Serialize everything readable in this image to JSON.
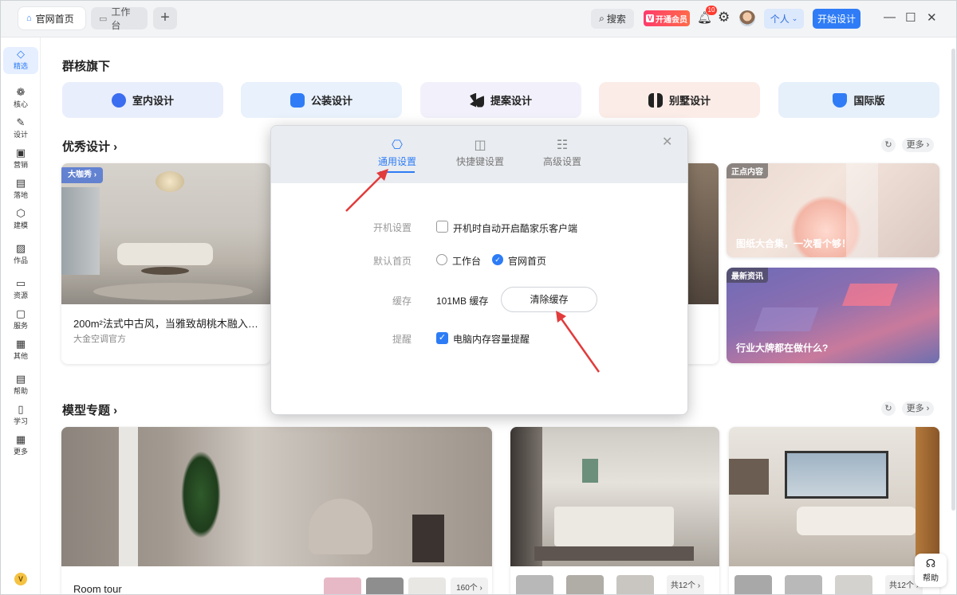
{
  "tabs": [
    {
      "label": "官网首页",
      "icon": "home-icon",
      "active": true
    },
    {
      "label": "工作台",
      "icon": "desktop-icon",
      "active": false
    }
  ],
  "topbar": {
    "search_label": "搜索",
    "vip_label": "开通会员",
    "vip_badge": "V",
    "notifications_count": "10",
    "personal_label": "个人",
    "start_label": "开始设计"
  },
  "sidebar": {
    "items": [
      {
        "label": "精选",
        "icon": "diamond-icon",
        "active": true
      },
      {
        "label": "核心",
        "icon": "cluster-icon"
      },
      {
        "label": "设计",
        "icon": "compass-icon"
      },
      {
        "label": "营销",
        "icon": "shopping-icon"
      },
      {
        "label": "落地",
        "icon": "clipboard-icon"
      },
      {
        "label": "建模",
        "icon": "cube-icon"
      },
      {
        "label": "作品",
        "icon": "image-icon"
      },
      {
        "label": "资源",
        "icon": "folder-icon"
      },
      {
        "label": "服务",
        "icon": "service-icon"
      },
      {
        "label": "其他",
        "icon": "grid-icon"
      },
      {
        "label": "帮助",
        "icon": "help-doc-icon"
      },
      {
        "label": "学习",
        "icon": "book-icon"
      },
      {
        "label": "更多",
        "icon": "more-grid-icon"
      }
    ],
    "bottom_badge": "V"
  },
  "main": {
    "group_title": "群核旗下",
    "group_cards": [
      {
        "label": "室内设计",
        "bg": "#e9eefc",
        "icon_color": "#3b6df0"
      },
      {
        "label": "公装设计",
        "bg": "#e8f1fc",
        "icon_color": "#2f7cf6"
      },
      {
        "label": "提案设计",
        "bg": "#f2f1fb",
        "icon_color": "#222222"
      },
      {
        "label": "别墅设计",
        "bg": "#fbece7",
        "icon_color": "#222222"
      },
      {
        "label": "国际版",
        "bg": "#e6f0fb",
        "icon_color": "#2f7cf6"
      }
    ],
    "excellent_title": "优秀设计 ›",
    "excellent_more": "更多 ›",
    "featured_card": {
      "tag": "大咖秀 ›",
      "caption": "200m²法式中古风，当雅致胡桃木融入…",
      "author": "大金空调官方"
    },
    "news_cards": [
      {
        "tag": "正点内容",
        "title": "图纸大合集，一次看个够！"
      },
      {
        "tag": "最新资讯",
        "title": "行业大牌都在做什么?"
      }
    ],
    "model_title": "模型专题 ›",
    "model_more": "更多 ›",
    "room_tour": "Room tour",
    "thumb_counts": [
      "160个 ›",
      "共12个 ›",
      "共12个 ›"
    ],
    "help_label": "帮助"
  },
  "dialog": {
    "tabs": [
      {
        "label": "通用设置",
        "icon": "gear-ring-icon",
        "active": true
      },
      {
        "label": "快捷键设置",
        "icon": "shortcut-grid-icon",
        "active": false
      },
      {
        "label": "高级设置",
        "icon": "advanced-list-icon",
        "active": false
      }
    ],
    "rows": {
      "startup_label": "开机设置",
      "startup_option": "开机时自动开启酷家乐客户端",
      "startup_checked": false,
      "home_label": "默认首页",
      "home_options": [
        "工作台",
        "官网首页"
      ],
      "home_selected": "官网首页",
      "cache_label": "缓存",
      "cache_value": "101MB 缓存",
      "clear_cache_label": "清除缓存",
      "remind_label": "提醒",
      "remind_option": "电脑内存容量提醒",
      "remind_checked": true
    }
  }
}
